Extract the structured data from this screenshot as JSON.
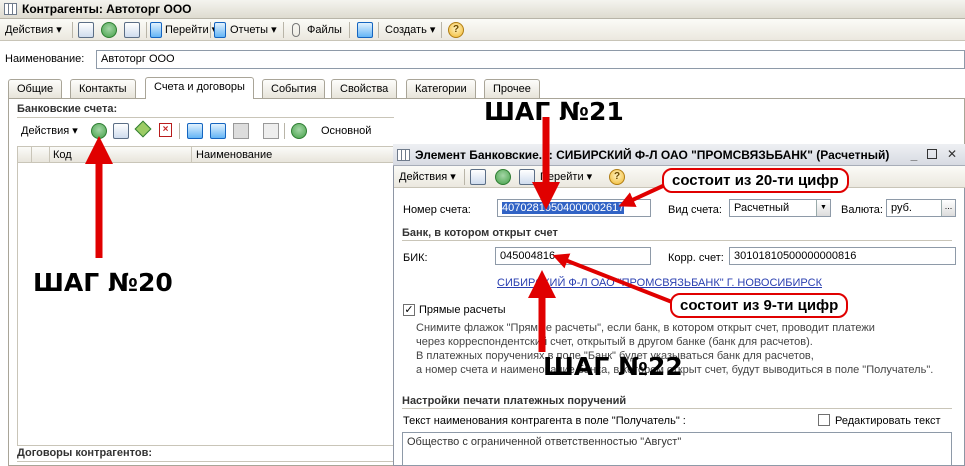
{
  "main_window": {
    "title": "Контрагенты: Автоторг ООО"
  },
  "main_toolbar": {
    "actions": "Действия",
    "goto": "Перейти",
    "reports": "Отчеты",
    "files": "Файлы",
    "create": "Создать",
    "help_glyph": "?"
  },
  "name_row": {
    "label": "Наименование:",
    "value": "Автоторг ООО"
  },
  "tabs": [
    {
      "label": "Общие"
    },
    {
      "label": "Контакты"
    },
    {
      "label": "Счета и договоры",
      "active": true
    },
    {
      "label": "События"
    },
    {
      "label": "Свойства"
    },
    {
      "label": "Категории"
    },
    {
      "label": "Прочее"
    }
  ],
  "bank_accounts": {
    "section_title": "Банковские счета:",
    "toolbar_actions": "Действия",
    "toolbar_main": "Основной",
    "columns": [
      "Код",
      "Наименование"
    ]
  },
  "contracts": {
    "section_title": "Договоры контрагентов:"
  },
  "dialog": {
    "title": "Элемент Банковские...: СИБИРСКИЙ Ф-Л ОАО \"ПРОМСВЯЗЬБАНК\" (Расчетный)",
    "toolbar_actions": "Действия",
    "toolbar_goto": "Перейти",
    "account_number_label": "Номер счета:",
    "account_number_value": "40702810504000002617",
    "account_type_label": "Вид счета:",
    "account_type_value": "Расчетный",
    "currency_label": "Валюта:",
    "currency_value": "руб.",
    "bank_section_title": "Банк, в котором открыт счет",
    "bik_label": "БИК:",
    "bik_value": "045004816",
    "corr_account_label": "Корр. счет:",
    "corr_account_value": "30101810500000000816",
    "bank_link": "СИБИРСКИЙ Ф-Л ОАО \"ПРОМСВЯЗЬБАНК\" Г. НОВОСИБИРСК",
    "direct_payments_label": "Прямые расчеты",
    "direct_payments_checked": true,
    "note_lines": [
      "Снимите флажок \"Прямые расчеты\", если банк, в котором открыт счет, проводит платежи",
      "через корреспондентский счет, открытый в другом банке (банк для расчетов).",
      "В платежных поручениях в поле \"Банк\" будет указываться банк для расчетов,",
      "а номер счета и наименование банка, в котором открыт счет, будут выводиться в поле \"Получатель\"."
    ],
    "print_section_title": "Настройки печати платежных поручений",
    "recipient_label": "Текст наименования контрагента в поле \"Получатель\" :",
    "edit_text_label": "Редактировать текст",
    "recipient_text": "Общество с ограниченной ответственностью \"Август\""
  },
  "annotations": {
    "step20": "ШАГ №20",
    "step21": "ШАГ №21",
    "step22": "ШАГ №22",
    "callout_20_digits": "состоит из 20-ти цифр",
    "callout_9_digits": "состоит из 9-ти цифр",
    "arrow_color": "#e00000"
  }
}
